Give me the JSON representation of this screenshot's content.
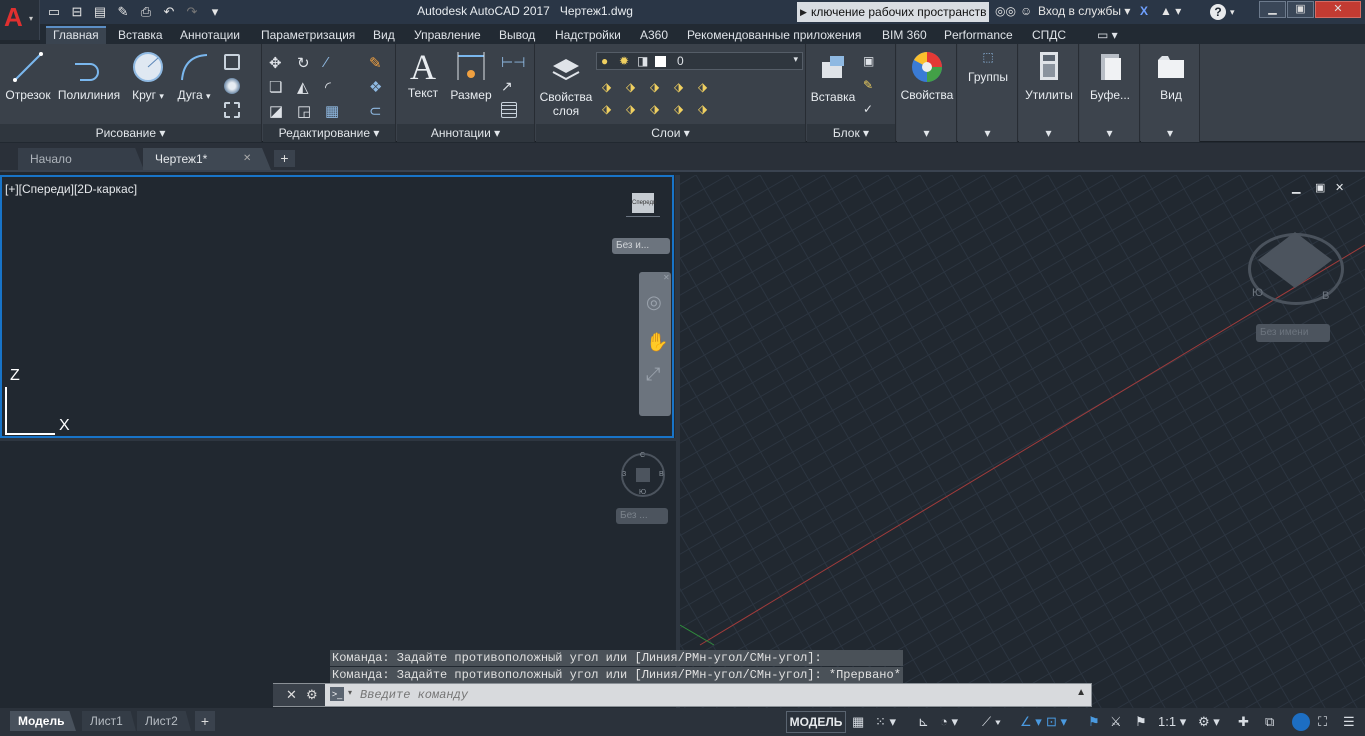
{
  "title_bar": {
    "app_title": "Autodesk AutoCAD 2017",
    "doc_title": "Чертеж1.dwg",
    "workspace_search": "ключение рабочих пространств",
    "sign_in": "Вход в службы",
    "min": "▁",
    "max": "▣",
    "close": "✕"
  },
  "app_menu": {
    "logo": "A",
    "caret": "▾"
  },
  "quick_access": {
    "icons": [
      "new-icon",
      "open-icon",
      "save-icon",
      "saveas-icon",
      "print-icon",
      "undo-icon",
      "redo-icon",
      "customize-icon"
    ],
    "glyphs": [
      "▭",
      "⊟",
      "▤",
      "✎",
      "⎙",
      "↶",
      "↷",
      "▾"
    ]
  },
  "ribbon_tabs": [
    "Главная",
    "Вставка",
    "Аннотации",
    "Параметризация",
    "Вид",
    "Управление",
    "Вывод",
    "Надстройки",
    "А360",
    "Рекомендованные приложения",
    "BIM 360",
    "Performance",
    "СПДС",
    "▭ ▾"
  ],
  "ribbon_active_tab": "Главная",
  "ribbon": {
    "draw": {
      "label": "Рисование ▾",
      "tools": [
        "Отрезок",
        "Полилиния",
        "Круг",
        "Дуга"
      ]
    },
    "modify": {
      "label": "Редактирование ▾"
    },
    "annotation": {
      "label": "Аннотации ▾",
      "tools": [
        "Текст",
        "Размер"
      ]
    },
    "layers": {
      "label": "Слои ▾",
      "properties_label": "Свойства слоя",
      "properties_line1": "Свойства",
      "properties_line2": "слоя",
      "current_layer": "0"
    },
    "block": {
      "label": "Блок ▾",
      "insert": "Вставка"
    },
    "properties": "Свойства",
    "groups": "Группы",
    "utilities": "Утилиты",
    "clipboard": "Буфе...",
    "view": "Вид"
  },
  "file_tabs": {
    "start": "Начало",
    "drawing": "Чертеж1*",
    "close": "✕",
    "new": "+"
  },
  "viewport_top_left": {
    "label": "[+][Спереди][2D-каркас]",
    "named_view": "Без и...",
    "viewcube_label": "Спереди",
    "axis_z": "Z",
    "axis_x": "X"
  },
  "viewport_bottom_left": {
    "compass": [
      "С",
      "З",
      "В",
      "Ю"
    ],
    "named_view": "Без ..."
  },
  "viewport_right": {
    "compass": [
      "Ю",
      "В"
    ],
    "named_view": "Без имени",
    "controls": [
      "▁",
      "▣",
      "✕"
    ]
  },
  "command": {
    "history": [
      "Команда: Задайте противоположный угол или [Линия/РМн-угол/СМн-угол]:",
      "Команда: Задайте противоположный угол или [Линия/РМн-угол/СМн-угол]: *Прервано*"
    ],
    "placeholder": "Введите команду"
  },
  "status_bar": {
    "tabs": [
      "Модель",
      "Лист1",
      "Лист2"
    ],
    "add": "+",
    "model": "МОДЕЛЬ",
    "scale": "1:1"
  },
  "colors": {
    "accent": "#1874c8",
    "ribbon_bg": "#3a414a",
    "canvas_bg": "#212830",
    "x_axis": "#a23b3b",
    "y_axis": "#2f8a3c"
  }
}
